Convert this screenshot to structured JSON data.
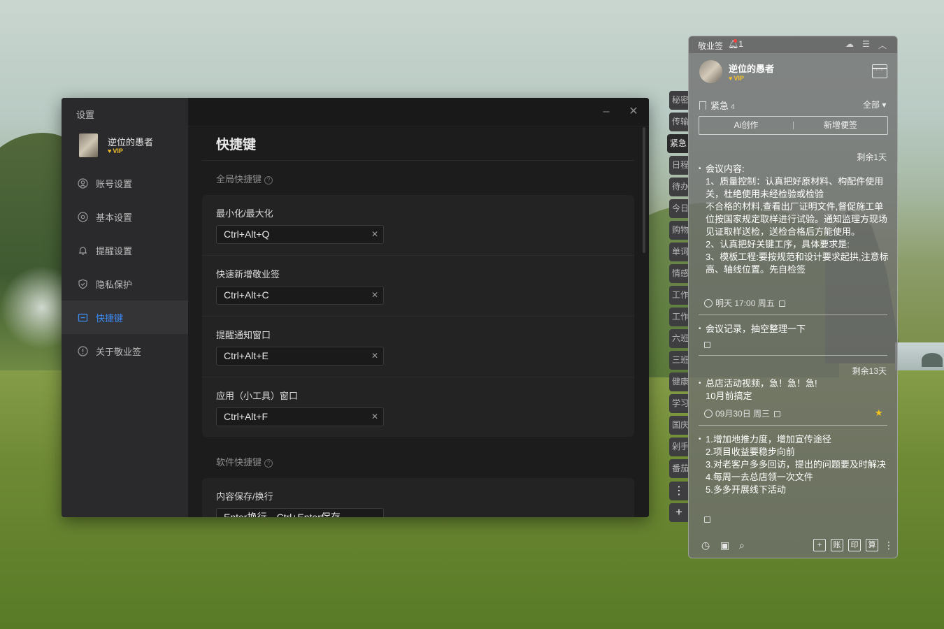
{
  "settings": {
    "title": "设置",
    "user": {
      "name": "逆位的愚者",
      "vip": "VIP"
    },
    "menu": [
      {
        "label": "账号设置",
        "icon": "account-icon"
      },
      {
        "label": "基本设置",
        "icon": "settings-icon"
      },
      {
        "label": "提醒设置",
        "icon": "bell-icon"
      },
      {
        "label": "隐私保护",
        "icon": "shield-icon"
      },
      {
        "label": "快捷键",
        "icon": "keyboard-icon"
      },
      {
        "label": "关于敬业签",
        "icon": "info-icon"
      }
    ],
    "active_menu": "快捷键",
    "page_title": "快捷键",
    "global_section": "全局快捷键",
    "software_section": "软件快捷键",
    "global_shortcuts": [
      {
        "label": "最小化/最大化",
        "value": "Ctrl+Alt+Q"
      },
      {
        "label": "快速新增敬业签",
        "value": "Ctrl+Alt+C"
      },
      {
        "label": "提醒通知窗口",
        "value": "Ctrl+Alt+E"
      },
      {
        "label": "应用（小工具）窗口",
        "value": "Ctrl+Alt+F"
      }
    ],
    "software_shortcuts": [
      {
        "label": "内容保存/换行",
        "value": "Enter换行，Ctrl+Enter保存"
      }
    ]
  },
  "tabs": [
    "秘密",
    "传输",
    "紧急",
    "日程",
    "待办",
    "今日",
    "购物",
    "单词",
    "情感",
    "工作",
    "工作",
    "六班",
    "三班",
    "健康",
    "学习",
    "国庆",
    "剁手",
    "番茄"
  ],
  "active_tab": "紧急",
  "notes": {
    "app": "敬业签",
    "bell_count": "1",
    "user": {
      "name": "逆位的愚者",
      "vip": "VIP"
    },
    "category": "紧急",
    "category_count": "4",
    "filter": "全部",
    "ai_button": "Ai创作",
    "new_button": "新增便签",
    "items": [
      {
        "remain": "剩余1天",
        "text": "会议内容:\n1、质量控制：认真把好原材料、构配件使用关，杜绝使用未经检验或检验\n不合格的材料,查看出厂证明文件,督促施工单位按国家规定取样进行试验。通知监理方现场见证取样送检，送检合格后方能使用。\n2、认真把好关键工序，具体要求是:\n3、模板工程:要按规范和设计要求起拱,注意标高、轴线位置。先自检签",
        "meta": "明天 17:00 周五"
      },
      {
        "remain": "",
        "text": "会议记录，抽空整理一下",
        "meta": ""
      },
      {
        "remain": "剩余13天",
        "text": "总店活动视频，急！急！急!\n10月前搞定",
        "meta": "09月30日 周三",
        "starred": true
      },
      {
        "remain": "",
        "text": "1.增加地推力度，增加宣传途径\n2.项目收益要稳步向前\n3.对老客户多多回访，提出的问题要及时解决\n4.每周一去总店领一次文件\n5.多多开展线下活动",
        "meta": ""
      }
    ],
    "footer": {
      "btn1": "+",
      "btn2": "账",
      "btn3": "印",
      "btn4": "算"
    }
  }
}
